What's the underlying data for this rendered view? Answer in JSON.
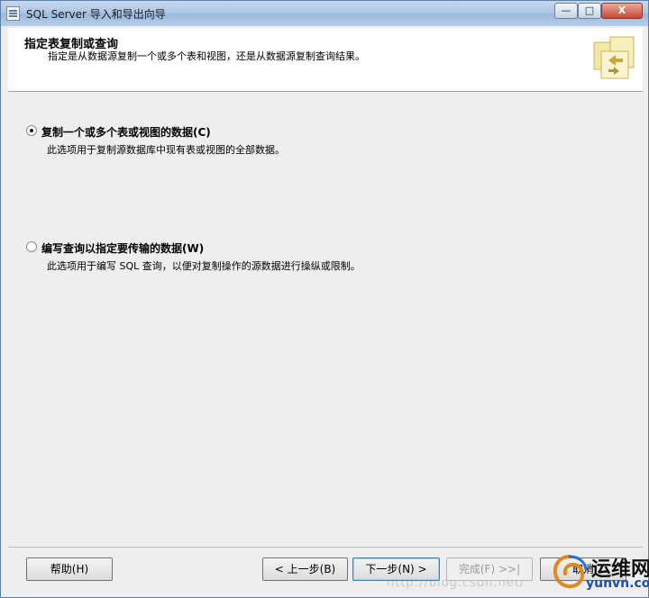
{
  "window": {
    "title": "SQL Server 导入和导出向导",
    "minimize_label": "—",
    "maximize_label": "□",
    "close_label": "X"
  },
  "header": {
    "title": "指定表复制或查询",
    "subtitle": "指定是从数据源复制一个或多个表和视图，还是从数据源复制查询结果。"
  },
  "options": [
    {
      "label": "复制一个或多个表或视图的数据(C)",
      "description": "此选项用于复制源数据库中现有表或视图的全部数据。",
      "selected": true
    },
    {
      "label": "编写查询以指定要传输的数据(W)",
      "description": "此选项用于编写 SQL 查询，以便对复制操作的源数据进行操纵或限制。",
      "selected": false
    }
  ],
  "footer": {
    "help_label": "帮助(H)",
    "back_label": "< 上一步(B)",
    "next_label": "下一步(N) >",
    "finish_label": "完成(F) >>|",
    "cancel_label": "取消",
    "watermark": "http://blog.csdn.net/"
  },
  "branding": {
    "logo_cn": "运维网",
    "logo_en": "yunvn.com",
    "accent_color": "#1b4fb0"
  }
}
